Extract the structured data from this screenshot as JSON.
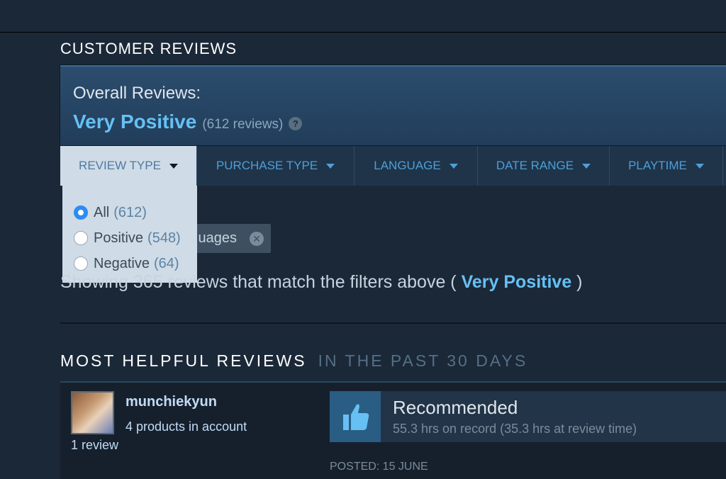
{
  "section_title": "CUSTOMER REVIEWS",
  "summary": {
    "label": "Overall Reviews:",
    "rating": "Very Positive",
    "count": "(612 reviews)",
    "help": "?"
  },
  "filters": {
    "tabs": [
      {
        "label": "REVIEW TYPE"
      },
      {
        "label": "PURCHASE TYPE"
      },
      {
        "label": "LANGUAGE"
      },
      {
        "label": "DATE RANGE"
      },
      {
        "label": "PLAYTIME"
      }
    ],
    "review_type_options": [
      {
        "label": "All",
        "count": "(612)",
        "selected": true
      },
      {
        "label": "Positive",
        "count": "(548)",
        "selected": false
      },
      {
        "label": "Negative",
        "count": "(64)",
        "selected": false
      }
    ]
  },
  "active_filter_chip": "uages",
  "showing": {
    "prefix": "Showing 365 reviews that match the filters above ( ",
    "rating": "Very Positive",
    "suffix": " )"
  },
  "most_helpful": {
    "title": "MOST HELPFUL REVIEWS",
    "subtitle": "IN THE PAST 30 DAYS"
  },
  "review": {
    "username": "munchiekyun",
    "products": "4 products in account",
    "review_count": "1 review",
    "verdict": "Recommended",
    "hours": "55.3 hrs on record (35.3 hrs at review time)",
    "posted": "POSTED: 15 JUNE"
  },
  "colors": {
    "background": "#1b2838",
    "accent": "#66c0f4",
    "radio_selected": "#2d8cf0"
  }
}
